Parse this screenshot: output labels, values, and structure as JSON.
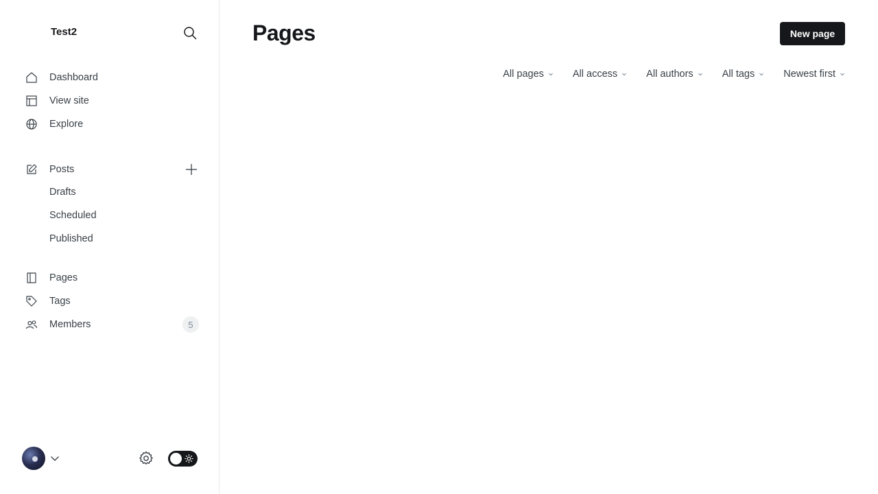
{
  "sidebar": {
    "site_title": "Test2",
    "primary_nav": [
      {
        "label": "Dashboard",
        "icon": "home-icon"
      },
      {
        "label": "View site",
        "icon": "layout-icon"
      },
      {
        "label": "Explore",
        "icon": "globe-icon"
      }
    ],
    "posts": {
      "label": "Posts",
      "icon": "edit-icon",
      "sub_items": [
        "Drafts",
        "Scheduled",
        "Published"
      ]
    },
    "secondary_nav": [
      {
        "label": "Pages",
        "icon": "pages-icon"
      },
      {
        "label": "Tags",
        "icon": "tag-icon"
      },
      {
        "label": "Members",
        "icon": "members-icon",
        "badge": "5"
      }
    ]
  },
  "main": {
    "title": "Pages",
    "new_button_label": "New page",
    "filters": [
      "All pages",
      "All access",
      "All authors",
      "All tags",
      "Newest first"
    ]
  },
  "colors": {
    "text_primary": "#15171a",
    "text_secondary": "#394047",
    "button_bg": "#15171a",
    "border": "#e6e9eb",
    "badge_bg": "#eff0f1"
  }
}
